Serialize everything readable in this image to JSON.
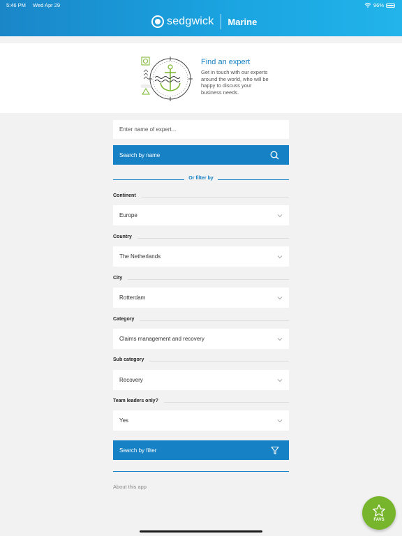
{
  "status_bar": {
    "time": "5:46 PM",
    "date": "Wed Apr 29",
    "battery": "96%"
  },
  "header": {
    "logo_text": "sedgwick",
    "app_name": "Marine"
  },
  "intro": {
    "title": "Find an expert",
    "description": "Get in touch with our experts around the world, who will be happy to discuss your business needs."
  },
  "search": {
    "placeholder": "Enter name of expert...",
    "button_label": "Search by name",
    "filter_divider": "Or filter by"
  },
  "filters": [
    {
      "label": "Continent",
      "value": "Europe"
    },
    {
      "label": "Country",
      "value": "The Netherlands"
    },
    {
      "label": "City",
      "value": "Rotterdam"
    },
    {
      "label": "Category",
      "value": "Claims management and recovery"
    },
    {
      "label": "Sub category",
      "value": "Recovery"
    },
    {
      "label": "Team leaders only?",
      "value": "Yes"
    }
  ],
  "filter_button_label": "Search by filter",
  "about_link": "About this app",
  "fab": {
    "label": "FAVS",
    "icon": "star-icon"
  },
  "colors": {
    "primary": "#1681c4",
    "header": "#1aa3e0",
    "fab": "#77b62c",
    "background": "#f2f2f2"
  }
}
